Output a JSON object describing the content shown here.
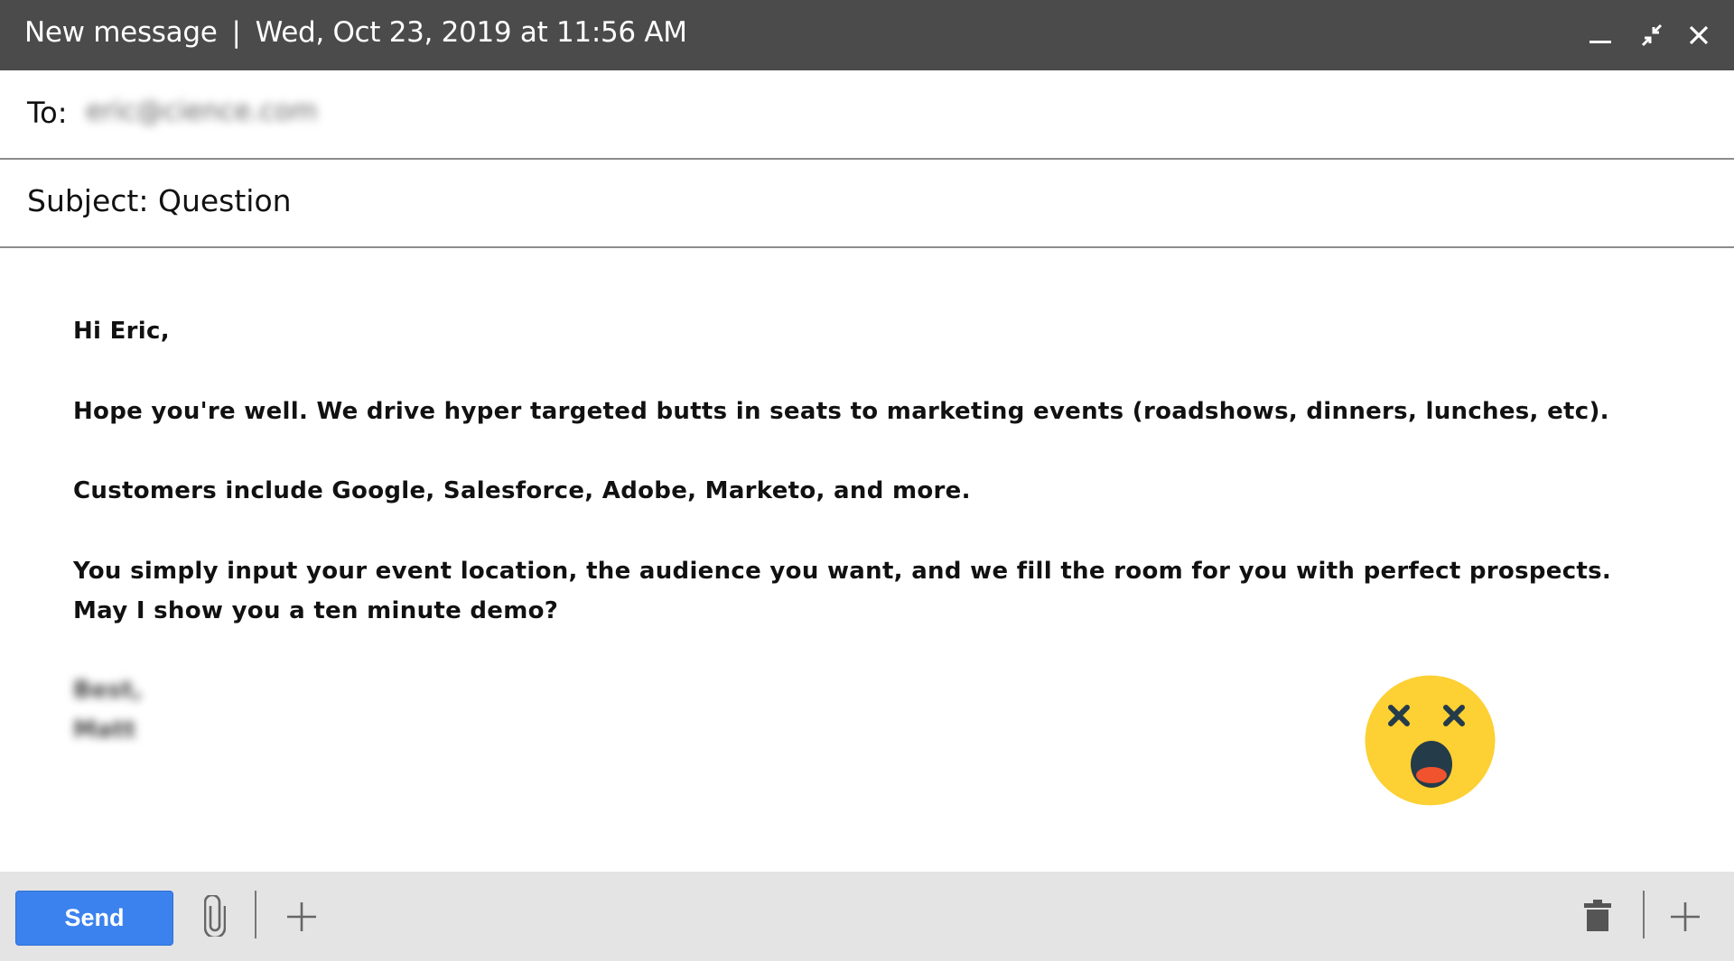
{
  "window": {
    "title": "New message",
    "separator": "|",
    "timestamp": "Wed, Oct 23, 2019 at 11:56 AM",
    "controls": {
      "minimize_icon": "minimize-icon",
      "collapse_icon": "exit-fullscreen-icon",
      "close_icon": "close-icon"
    }
  },
  "compose": {
    "to_label": "To:",
    "to_value": "eric@cience.com",
    "subject_text": "Subject: Question",
    "body": {
      "greeting": "Hi Eric,",
      "paragraph_1": "Hope you're well. We drive hyper targeted butts in seats to marketing events (roadshows, dinners, lunches, etc).",
      "paragraph_2": "Customers include Google, Salesforce, Adobe, Marketo, and more.",
      "paragraph_3_line_1": "You simply input your event location, the audience you want, and we fill the room for you with perfect prospects.",
      "paragraph_3_line_2": "May I show you a ten minute demo?",
      "signoff": "Best,",
      "signature_name": "Matt"
    },
    "reaction_emoji": "dizzy-shocked-face-icon"
  },
  "footer": {
    "send_label": "Send",
    "attach_icon": "paperclip-icon",
    "more_icon": "plus-icon",
    "discard_icon": "trash-icon",
    "options_icon": "plus-icon"
  },
  "colors": {
    "titlebar": "#4b4b4b",
    "send_button": "#3b82ee",
    "footer": "#e4e4e4",
    "emoji_face": "#fdd033",
    "emoji_features": "#243b4a",
    "emoji_tongue": "#f0532d"
  }
}
